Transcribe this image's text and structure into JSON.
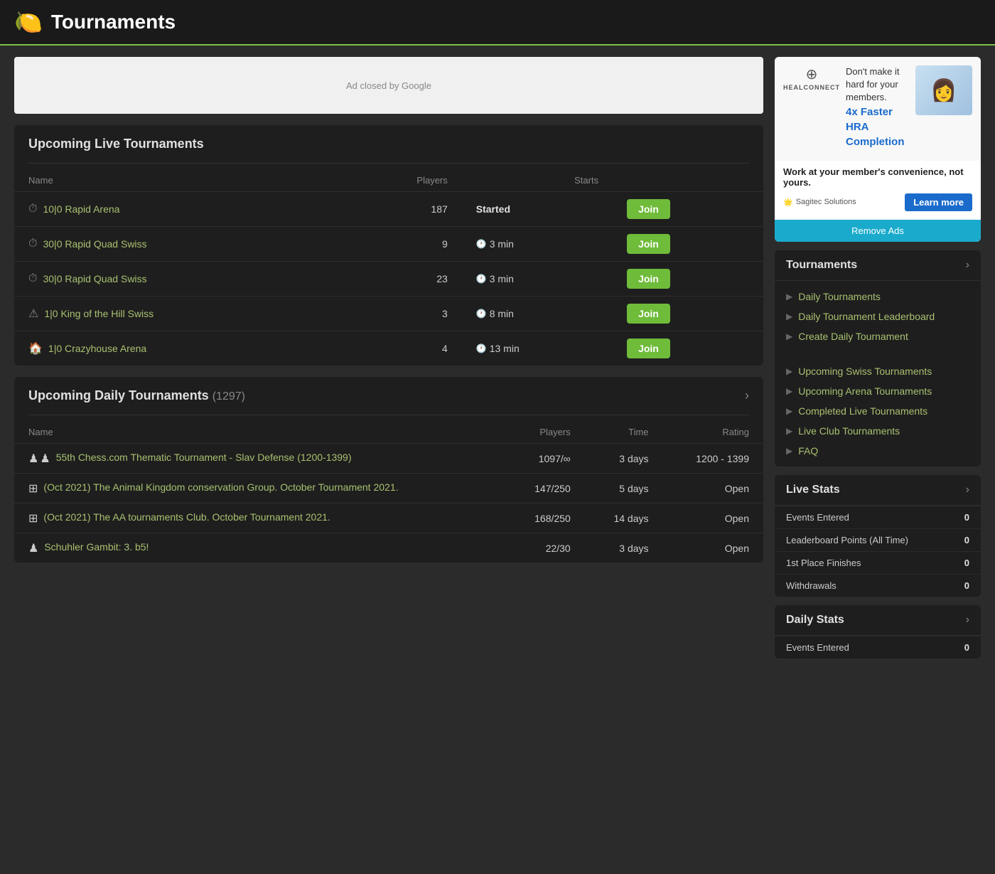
{
  "header": {
    "icon": "🍋",
    "title": "Tournaments"
  },
  "ad_banner": {
    "text": "Ad closed by Google"
  },
  "upcoming_live": {
    "title": "Upcoming Live Tournaments",
    "columns": [
      "Name",
      "Players",
      "Starts"
    ],
    "rows": [
      {
        "icon": "⏱",
        "name": "10|0 Rapid Arena",
        "players": "187",
        "starts": "Started",
        "started": true
      },
      {
        "icon": "⏱",
        "name": "30|0 Rapid Quad Swiss",
        "players": "9",
        "starts": "3 min",
        "started": false
      },
      {
        "icon": "⏱",
        "name": "30|0 Rapid Quad Swiss",
        "players": "23",
        "starts": "3 min",
        "started": false
      },
      {
        "icon": "⚠",
        "name": "1|0 King of the Hill Swiss",
        "players": "3",
        "starts": "8 min",
        "started": false
      },
      {
        "icon": "🏠",
        "name": "1|0 Crazyhouse Arena",
        "players": "4",
        "starts": "13 min",
        "started": false
      }
    ],
    "join_label": "Join"
  },
  "upcoming_daily": {
    "title": "Upcoming Daily Tournaments",
    "count": "(1297)",
    "columns": [
      "Name",
      "Players",
      "Time",
      "Rating"
    ],
    "rows": [
      {
        "icons": [
          "♟",
          "♟"
        ],
        "name": "55th Chess.com Thematic Tournament - Slav Defense (1200-1399)",
        "players": "1097/∞",
        "time": "3 days",
        "rating": "1200 - 1399"
      },
      {
        "icons": [
          "⊞"
        ],
        "name": "(Oct 2021) The Animal Kingdom conservation Group. October Tournament 2021.",
        "players": "147/250",
        "time": "5 days",
        "rating": "Open"
      },
      {
        "icons": [
          "⊞"
        ],
        "name": "(Oct 2021) The AA tournaments Club. October Tournament 2021.",
        "players": "168/250",
        "time": "14 days",
        "rating": "Open"
      },
      {
        "icons": [
          "♟"
        ],
        "name": "Schuhler Gambit: 3. b5!",
        "players": "22/30",
        "time": "3 days",
        "rating": "Open"
      }
    ]
  },
  "sidebar": {
    "ad": {
      "logo_icon": "⊕",
      "logo_text": "HEALCONNECT",
      "headline_plain": "Don't make it hard for your members.",
      "headline_accent": "4x Faster HRA Completion",
      "description": "Work at your member's convenience, not yours.",
      "brand_icon": "🌟",
      "brand_name": "Sagitec Solutions",
      "learn_more": "Learn more",
      "remove_ads": "Remove Ads"
    },
    "tournaments_section": {
      "title": "Tournaments",
      "items": [
        {
          "label": "Daily Tournaments"
        },
        {
          "label": "Daily Tournament Leaderboard"
        },
        {
          "label": "Create Daily Tournament"
        },
        {
          "label": "Upcoming Swiss Tournaments"
        },
        {
          "label": "Upcoming Arena Tournaments"
        },
        {
          "label": "Completed Live Tournaments"
        },
        {
          "label": "Live Club Tournaments"
        },
        {
          "label": "FAQ"
        }
      ]
    },
    "live_stats": {
      "title": "Live Stats",
      "stats": [
        {
          "label": "Events Entered",
          "value": "0"
        },
        {
          "label": "Leaderboard Points (All Time)",
          "value": "0"
        },
        {
          "label": "1st Place Finishes",
          "value": "0"
        },
        {
          "label": "Withdrawals",
          "value": "0"
        }
      ]
    },
    "daily_stats": {
      "title": "Daily Stats",
      "stats": [
        {
          "label": "Events Entered",
          "value": "0"
        }
      ]
    }
  }
}
